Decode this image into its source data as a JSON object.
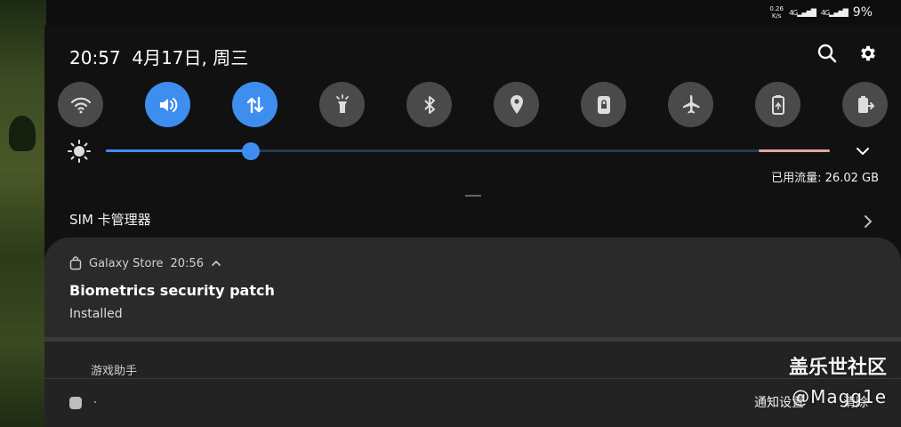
{
  "status_bar": {
    "net_speed_value": "0.26",
    "net_speed_unit": "K/s",
    "sim1_network": "4G",
    "sim2_network": "4G",
    "battery_percent": "9%"
  },
  "header": {
    "time": "20:57",
    "date": "4月17日, 周三",
    "search_icon": "search-icon",
    "settings_icon": "gear-icon"
  },
  "quick_tiles": [
    {
      "name": "wifi",
      "icon": "wifi-icon",
      "active": false
    },
    {
      "name": "sound",
      "icon": "volume-icon",
      "active": true
    },
    {
      "name": "mobile-data",
      "icon": "data-arrows-icon",
      "active": true
    },
    {
      "name": "flashlight",
      "icon": "flashlight-icon",
      "active": false
    },
    {
      "name": "bluetooth",
      "icon": "bluetooth-icon",
      "active": false
    },
    {
      "name": "location",
      "icon": "location-pin-icon",
      "active": false
    },
    {
      "name": "screen-lock",
      "icon": "lock-icon",
      "active": false
    },
    {
      "name": "airplane-mode",
      "icon": "airplane-icon",
      "active": false
    },
    {
      "name": "power-saving",
      "icon": "battery-recycle-icon",
      "active": false
    },
    {
      "name": "power-share",
      "icon": "battery-share-icon",
      "active": false
    }
  ],
  "brightness": {
    "level": 0.2,
    "icon": "sun-icon",
    "colors": {
      "active": "#3e8ef0",
      "track": "#233b52",
      "warning": "#e8a3a3"
    }
  },
  "data_usage": "已用流量: 26.02 GB",
  "sim_manager": "SIM 卡管理器",
  "notification": {
    "app": "Galaxy Store",
    "time": "20:56",
    "title": "Biometrics security patch",
    "body": "Installed"
  },
  "game_helper": "游戏助手",
  "footer": {
    "notif_settings": "通知设置",
    "clear": "清除"
  },
  "watermark": {
    "line1": "盖乐世社区",
    "line2": "@Magg1e"
  }
}
